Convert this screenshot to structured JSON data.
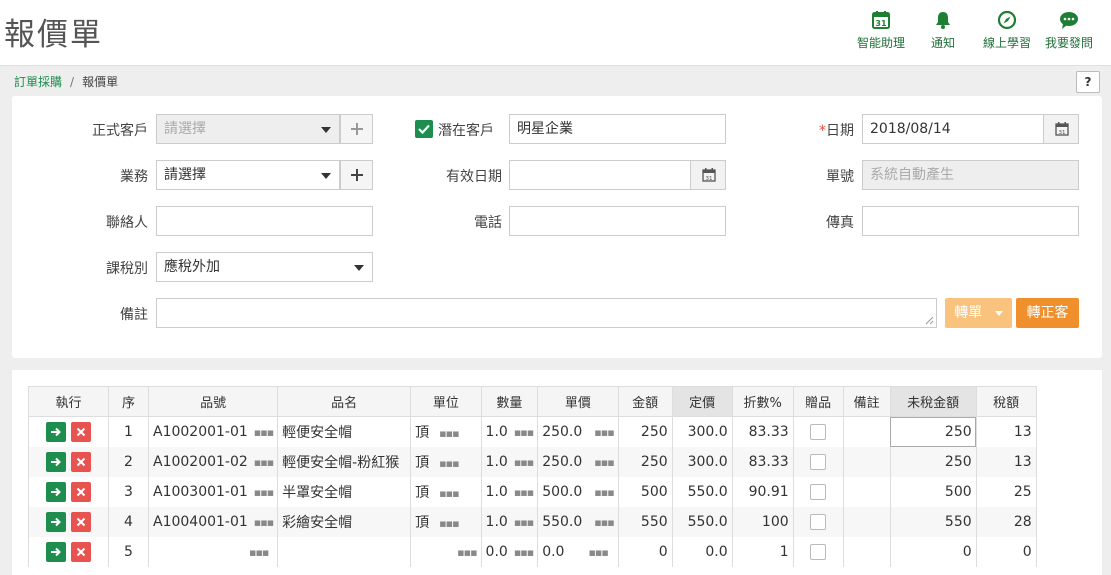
{
  "page": {
    "title": "報價單"
  },
  "header_actions": [
    {
      "label": "智能助理",
      "icon": "calendar-31-icon"
    },
    {
      "label": "通知",
      "icon": "bell-icon"
    },
    {
      "label": "線上學習",
      "icon": "compass-icon"
    },
    {
      "label": "我要發問",
      "icon": "chat-bubble-icon"
    }
  ],
  "breadcrumb": {
    "parent": "訂單採購",
    "separator": "/",
    "current": "報價單"
  },
  "help": "?",
  "form": {
    "customer": {
      "label": "正式客戶",
      "placeholder": "請選擇"
    },
    "potential": {
      "label": "潛在客戶",
      "value": "明星企業",
      "checked": true
    },
    "date": {
      "required_mark": "*",
      "label": "日期",
      "value": "2018/08/14"
    },
    "sales": {
      "label": "業務",
      "value": "請選擇"
    },
    "valid_date": {
      "label": "有效日期",
      "value": ""
    },
    "order_no": {
      "label": "單號",
      "placeholder": "系統自動產生"
    },
    "contact": {
      "label": "聯絡人",
      "value": ""
    },
    "phone": {
      "label": "電話",
      "value": ""
    },
    "fax": {
      "label": "傳真",
      "value": ""
    },
    "tax_type": {
      "label": "課稅別",
      "value": "應稅外加"
    },
    "remark": {
      "label": "備註",
      "value": ""
    },
    "calendar_day": "31",
    "btn_convert": "轉單",
    "btn_to_customer": "轉正客"
  },
  "table": {
    "headers": [
      "執行",
      "序",
      "品號",
      "品名",
      "單位",
      "數量",
      "單價",
      "金額",
      "定價",
      "折數%",
      "贈品",
      "備註",
      "未稅金額",
      "稅額"
    ],
    "rows": [
      {
        "seq": "1",
        "code": "A1002001-01",
        "name": "輕便安全帽",
        "unit": "頂",
        "qty": "1.0",
        "price": "250.0",
        "amount": "250",
        "list_price": "300.0",
        "discount": "83.33",
        "remark": "",
        "net": "250",
        "tax": "13"
      },
      {
        "seq": "2",
        "code": "A1002001-02",
        "name": "輕便安全帽-粉紅猴",
        "unit": "頂",
        "qty": "1.0",
        "price": "250.0",
        "amount": "250",
        "list_price": "300.0",
        "discount": "83.33",
        "remark": "",
        "net": "250",
        "tax": "13"
      },
      {
        "seq": "3",
        "code": "A1003001-01",
        "name": "半罩安全帽",
        "unit": "頂",
        "qty": "1.0",
        "price": "500.0",
        "amount": "500",
        "list_price": "550.0",
        "discount": "90.91",
        "remark": "",
        "net": "500",
        "tax": "25"
      },
      {
        "seq": "4",
        "code": "A1004001-01",
        "name": "彩繪安全帽",
        "unit": "頂",
        "qty": "1.0",
        "price": "550.0",
        "amount": "550",
        "list_price": "550.0",
        "discount": "100",
        "remark": "",
        "net": "550",
        "tax": "28"
      },
      {
        "seq": "5",
        "code": "",
        "name": "",
        "unit": "",
        "qty": "0.0",
        "price": "0.0",
        "amount": "0",
        "list_price": "0.0",
        "discount": "1",
        "remark": "",
        "net": "0",
        "tax": "0"
      }
    ]
  },
  "colors": {
    "green": "#1e8e4e",
    "red": "#e8534f",
    "orange": "#f0902c",
    "orange_light": "#f9c37e"
  }
}
